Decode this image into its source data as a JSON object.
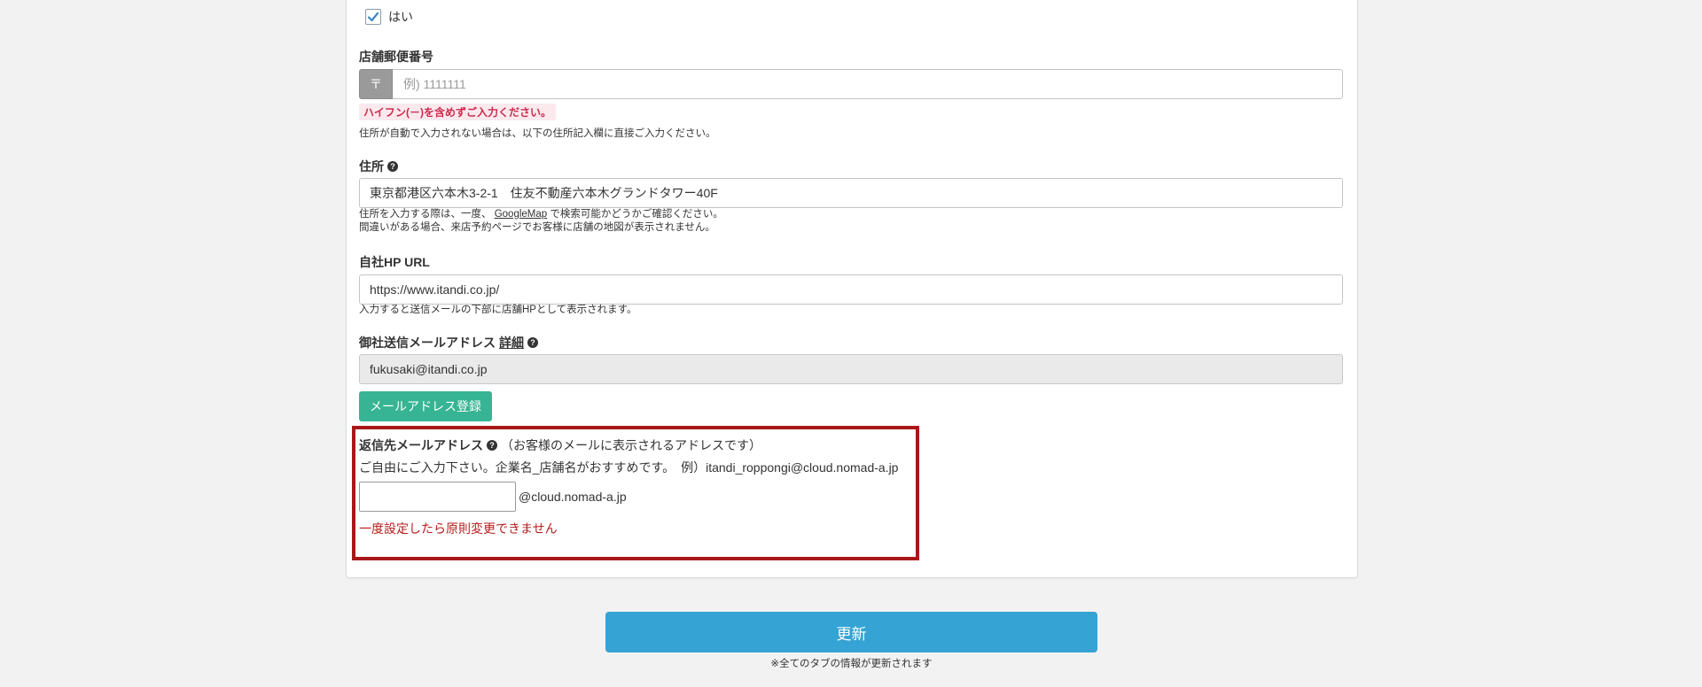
{
  "consent": {
    "label": "はい",
    "checked": true
  },
  "postal": {
    "label": "店舗郵便番号",
    "addon": "〒",
    "placeholder": "例) 1111111",
    "error": "ハイフン(－)を含めずご入力ください。",
    "help": "住所が自動で入力されない場合は、以下の住所記入欄に直接ご入力ください。"
  },
  "address": {
    "label": "住所",
    "value": "東京都港区六本木3-2-1　住友不動産六本木グランドタワー40F",
    "help_line1_before": "住所を入力する際は、一度、 ",
    "help_link": "GoogleMap",
    "help_line1_after": " で検索可能かどうかご確認ください。",
    "help_line2": "間違いがある場合、来店予約ページでお客様に店舗の地図が表示されません。"
  },
  "homepage": {
    "label": "自社HP URL",
    "value": "https://www.itandi.co.jp/",
    "help": "入力すると送信メールの下部に店舗HPとして表示されます。"
  },
  "sender_email": {
    "label": "御社送信メールアドレス",
    "detail_link": "詳細",
    "value": "fukusaki@itandi.co.jp",
    "register_button": "メールアドレス登録"
  },
  "reply_email": {
    "label": "返信先メールアドレス",
    "note": "（お客様のメールに表示されるアドレスです）",
    "hint": "ご自由にご入力下さい。企業名_店舗名がおすすめです。　例）itandi_roppongi@cloud.nomad-a.jp",
    "value": "",
    "domain": "@cloud.nomad-a.jp",
    "warning": "一度設定したら原則変更できません"
  },
  "footer": {
    "update_button": "更新",
    "update_note": "※全てのタブの情報が更新されます"
  },
  "colors": {
    "accent_green": "#36b493",
    "accent_blue": "#35a3d4",
    "highlight_red": "#a81818",
    "error_pink": "#cc2a4d"
  }
}
